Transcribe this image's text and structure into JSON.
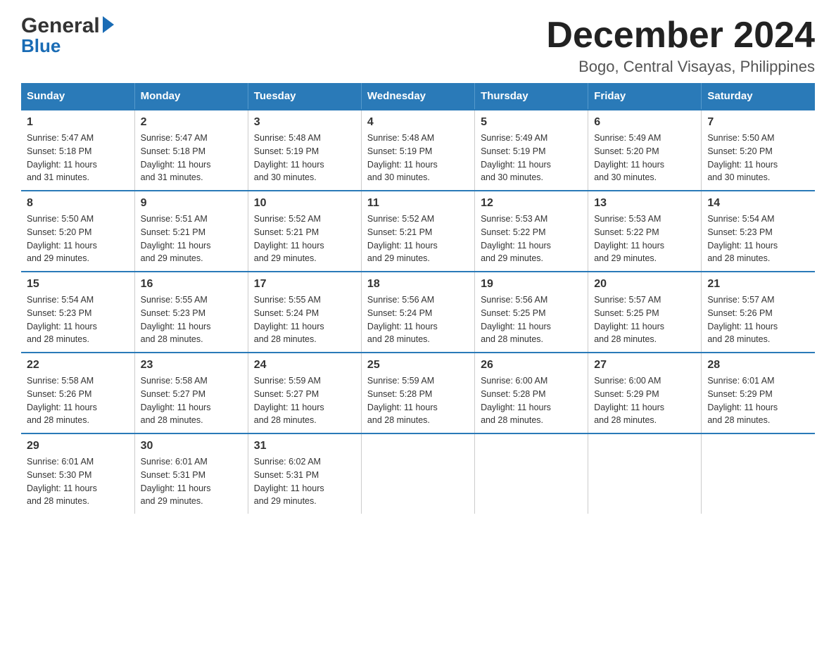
{
  "logo": {
    "general": "General",
    "blue": "Blue"
  },
  "title": "December 2024",
  "subtitle": "Bogo, Central Visayas, Philippines",
  "days_header": [
    "Sunday",
    "Monday",
    "Tuesday",
    "Wednesday",
    "Thursday",
    "Friday",
    "Saturday"
  ],
  "weeks": [
    [
      {
        "day": "1",
        "sunrise": "5:47 AM",
        "sunset": "5:18 PM",
        "daylight": "11 hours and 31 minutes."
      },
      {
        "day": "2",
        "sunrise": "5:47 AM",
        "sunset": "5:18 PM",
        "daylight": "11 hours and 31 minutes."
      },
      {
        "day": "3",
        "sunrise": "5:48 AM",
        "sunset": "5:19 PM",
        "daylight": "11 hours and 30 minutes."
      },
      {
        "day": "4",
        "sunrise": "5:48 AM",
        "sunset": "5:19 PM",
        "daylight": "11 hours and 30 minutes."
      },
      {
        "day": "5",
        "sunrise": "5:49 AM",
        "sunset": "5:19 PM",
        "daylight": "11 hours and 30 minutes."
      },
      {
        "day": "6",
        "sunrise": "5:49 AM",
        "sunset": "5:20 PM",
        "daylight": "11 hours and 30 minutes."
      },
      {
        "day": "7",
        "sunrise": "5:50 AM",
        "sunset": "5:20 PM",
        "daylight": "11 hours and 30 minutes."
      }
    ],
    [
      {
        "day": "8",
        "sunrise": "5:50 AM",
        "sunset": "5:20 PM",
        "daylight": "11 hours and 29 minutes."
      },
      {
        "day": "9",
        "sunrise": "5:51 AM",
        "sunset": "5:21 PM",
        "daylight": "11 hours and 29 minutes."
      },
      {
        "day": "10",
        "sunrise": "5:52 AM",
        "sunset": "5:21 PM",
        "daylight": "11 hours and 29 minutes."
      },
      {
        "day": "11",
        "sunrise": "5:52 AM",
        "sunset": "5:21 PM",
        "daylight": "11 hours and 29 minutes."
      },
      {
        "day": "12",
        "sunrise": "5:53 AM",
        "sunset": "5:22 PM",
        "daylight": "11 hours and 29 minutes."
      },
      {
        "day": "13",
        "sunrise": "5:53 AM",
        "sunset": "5:22 PM",
        "daylight": "11 hours and 29 minutes."
      },
      {
        "day": "14",
        "sunrise": "5:54 AM",
        "sunset": "5:23 PM",
        "daylight": "11 hours and 28 minutes."
      }
    ],
    [
      {
        "day": "15",
        "sunrise": "5:54 AM",
        "sunset": "5:23 PM",
        "daylight": "11 hours and 28 minutes."
      },
      {
        "day": "16",
        "sunrise": "5:55 AM",
        "sunset": "5:23 PM",
        "daylight": "11 hours and 28 minutes."
      },
      {
        "day": "17",
        "sunrise": "5:55 AM",
        "sunset": "5:24 PM",
        "daylight": "11 hours and 28 minutes."
      },
      {
        "day": "18",
        "sunrise": "5:56 AM",
        "sunset": "5:24 PM",
        "daylight": "11 hours and 28 minutes."
      },
      {
        "day": "19",
        "sunrise": "5:56 AM",
        "sunset": "5:25 PM",
        "daylight": "11 hours and 28 minutes."
      },
      {
        "day": "20",
        "sunrise": "5:57 AM",
        "sunset": "5:25 PM",
        "daylight": "11 hours and 28 minutes."
      },
      {
        "day": "21",
        "sunrise": "5:57 AM",
        "sunset": "5:26 PM",
        "daylight": "11 hours and 28 minutes."
      }
    ],
    [
      {
        "day": "22",
        "sunrise": "5:58 AM",
        "sunset": "5:26 PM",
        "daylight": "11 hours and 28 minutes."
      },
      {
        "day": "23",
        "sunrise": "5:58 AM",
        "sunset": "5:27 PM",
        "daylight": "11 hours and 28 minutes."
      },
      {
        "day": "24",
        "sunrise": "5:59 AM",
        "sunset": "5:27 PM",
        "daylight": "11 hours and 28 minutes."
      },
      {
        "day": "25",
        "sunrise": "5:59 AM",
        "sunset": "5:28 PM",
        "daylight": "11 hours and 28 minutes."
      },
      {
        "day": "26",
        "sunrise": "6:00 AM",
        "sunset": "5:28 PM",
        "daylight": "11 hours and 28 minutes."
      },
      {
        "day": "27",
        "sunrise": "6:00 AM",
        "sunset": "5:29 PM",
        "daylight": "11 hours and 28 minutes."
      },
      {
        "day": "28",
        "sunrise": "6:01 AM",
        "sunset": "5:29 PM",
        "daylight": "11 hours and 28 minutes."
      }
    ],
    [
      {
        "day": "29",
        "sunrise": "6:01 AM",
        "sunset": "5:30 PM",
        "daylight": "11 hours and 28 minutes."
      },
      {
        "day": "30",
        "sunrise": "6:01 AM",
        "sunset": "5:31 PM",
        "daylight": "11 hours and 29 minutes."
      },
      {
        "day": "31",
        "sunrise": "6:02 AM",
        "sunset": "5:31 PM",
        "daylight": "11 hours and 29 minutes."
      },
      null,
      null,
      null,
      null
    ]
  ],
  "labels": {
    "sunrise": "Sunrise:",
    "sunset": "Sunset:",
    "daylight": "Daylight:"
  }
}
